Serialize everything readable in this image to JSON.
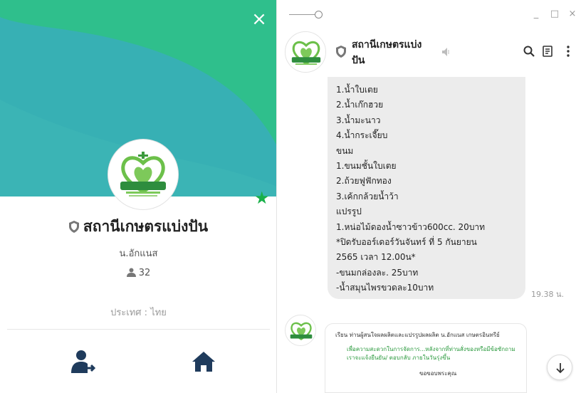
{
  "profile": {
    "name": "สถานีเกษตรแบ่งปัน",
    "subtitle": "น.อักแนส",
    "member_count": "32",
    "country": "ประเทศ : ไทย",
    "close_symbol": "×",
    "favorite_symbol": "★",
    "icons": {
      "close": "close-icon",
      "favorite": "star-icon",
      "shield": "shield-icon",
      "members": "person-icon",
      "leave": "user-leave-icon",
      "home": "home-icon"
    }
  },
  "chat": {
    "title_line1": "สถานีเกษตรแบ่ง",
    "title_line2": "ปัน",
    "window_controls": {
      "minimize": "_",
      "maximize": "□",
      "close": "×"
    },
    "icons": {
      "search": "search-icon",
      "notes": "notes-icon",
      "more": "more-icon",
      "mute": "speaker-mute-icon",
      "scroll_down": "arrow-down-icon"
    },
    "message": {
      "lines": [
        "1.น้ำใบเตย",
        "2.น้ำเก๊กฮวย",
        "3.น้ำมะนาว",
        "4.น้ำกระเจี๊ยบ",
        "ขนม",
        "1.ขนมชั้นใบเตย",
        "2.ถ้วยฟูฟักทอง",
        "3.เค้กกล้วยน้ำว้า",
        "แปรรูป",
        "1.หน่อไม้ดองน้ำซาวข้าว600cc. 20บาท",
        "*ปิดรับออร์เดอร์วันจันทร์ ที่ 5 กันยายน",
        "2565 เวลา 12.00น*",
        "-ขนมกล่องละ.         25บาท",
        "-น้ำสมุนไพรขวดละ10บาท"
      ],
      "time": "19.38 น."
    },
    "card": {
      "line1": "เรียน  ท่านผู้สนใจผลผลิตและแปรรูปผลผลิต น.อักแนส เกษตรอินทรีย์",
      "line2": "เพื่อความสะดวกในการจัดการ...หลังจากที่ท่านสั่งของหรือมีข้อซักถาม",
      "line3": "เราจะแจ้งยืนยัน/ ตอบกลับ ภายในวันรุ่งขึ้น",
      "line4": "ขอขอบพระคุณ"
    }
  },
  "colors": {
    "cover_teal": "#3bb3b3",
    "cover_green": "#2fbf8c",
    "accent_green": "#19b04a",
    "bubble_gray": "#ececec",
    "text_dark": "#222222",
    "text_muted": "#9a9a9a"
  }
}
